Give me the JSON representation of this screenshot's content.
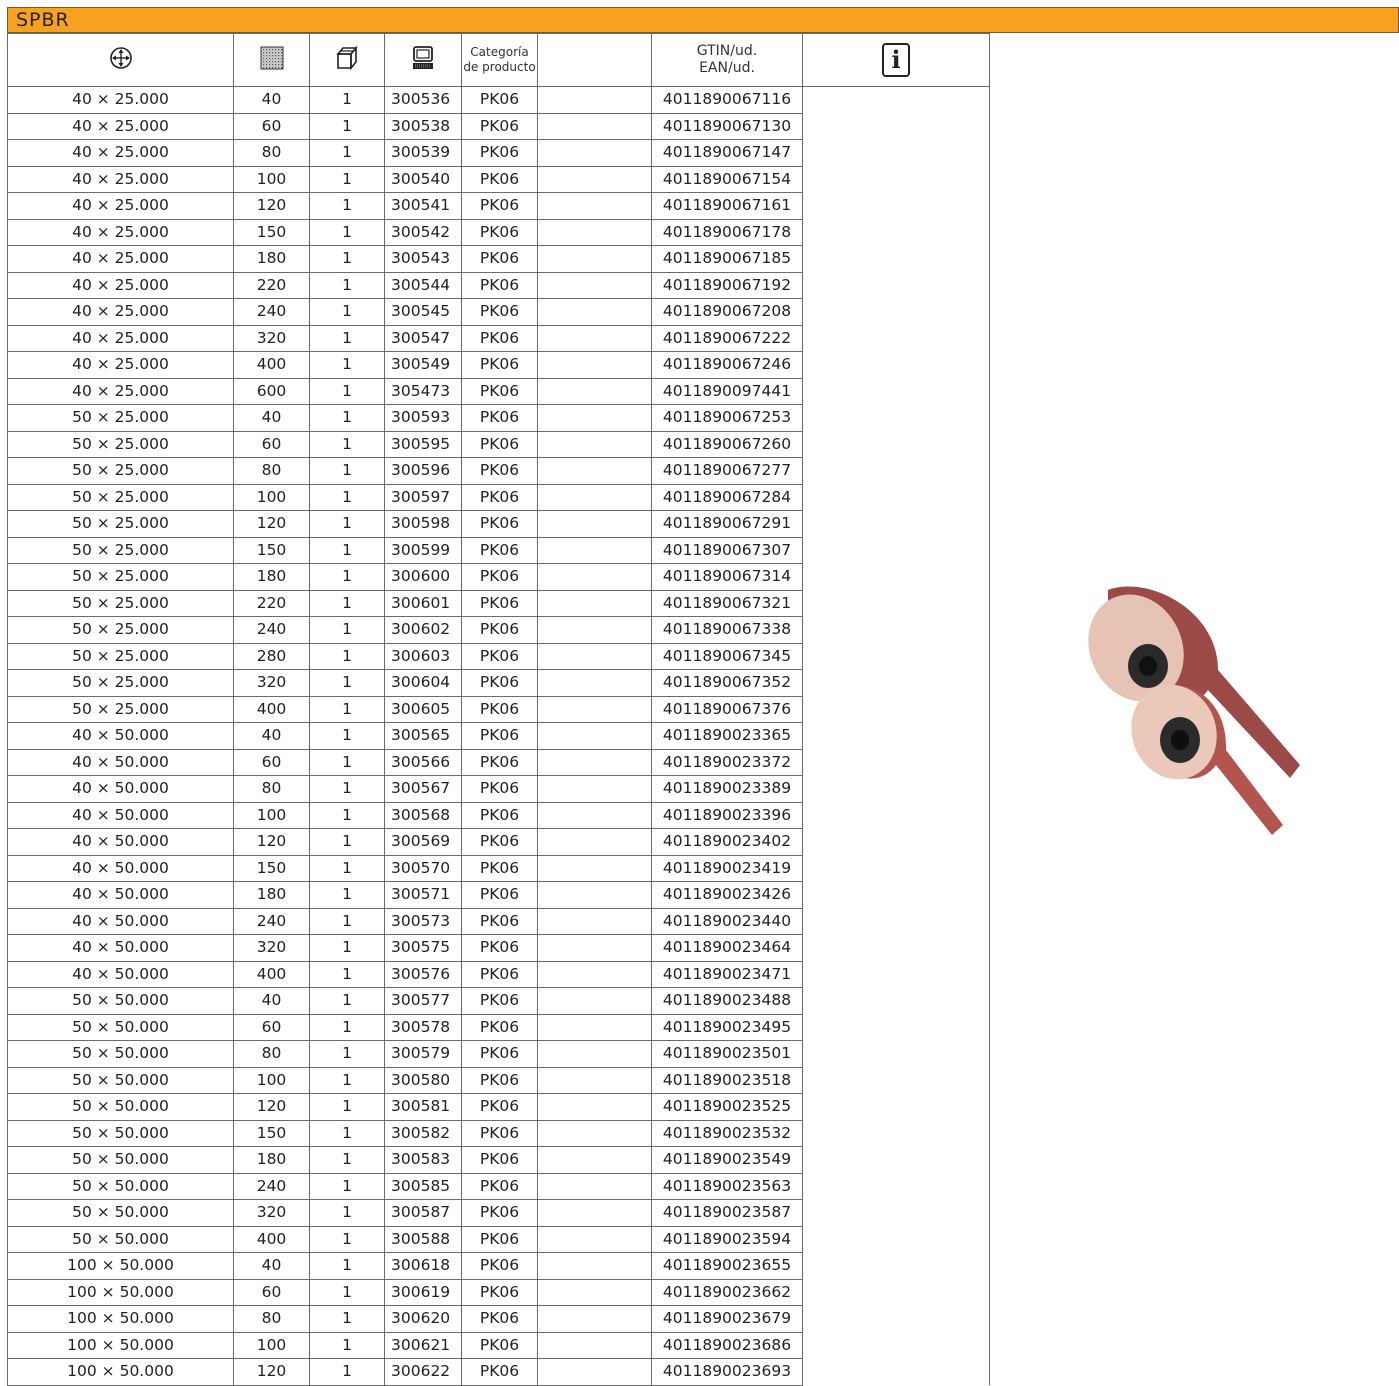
{
  "title": "SPBR",
  "colors": {
    "title_bar": "#f7a11e",
    "grid": "#6b6b6b"
  },
  "header": {
    "dimensions_icon": "arrows-cross-circle-icon",
    "grit_icon": "grit-texture-icon",
    "pack_icon": "box-icon",
    "article_icon": "computer-icon",
    "category": [
      "Categoría",
      "de producto"
    ],
    "gtin": [
      "GTIN/ud.",
      "EAN/ud."
    ],
    "info_icon": "info-icon",
    "info_label": "i"
  },
  "rows": [
    {
      "dim": "40 × 25.000",
      "grit": "40",
      "pack": "1",
      "art": "300536",
      "cat": "PK06",
      "gtin": "4011890067116"
    },
    {
      "dim": "40 × 25.000",
      "grit": "60",
      "pack": "1",
      "art": "300538",
      "cat": "PK06",
      "gtin": "4011890067130"
    },
    {
      "dim": "40 × 25.000",
      "grit": "80",
      "pack": "1",
      "art": "300539",
      "cat": "PK06",
      "gtin": "4011890067147"
    },
    {
      "dim": "40 × 25.000",
      "grit": "100",
      "pack": "1",
      "art": "300540",
      "cat": "PK06",
      "gtin": "4011890067154"
    },
    {
      "dim": "40 × 25.000",
      "grit": "120",
      "pack": "1",
      "art": "300541",
      "cat": "PK06",
      "gtin": "4011890067161"
    },
    {
      "dim": "40 × 25.000",
      "grit": "150",
      "pack": "1",
      "art": "300542",
      "cat": "PK06",
      "gtin": "4011890067178"
    },
    {
      "dim": "40 × 25.000",
      "grit": "180",
      "pack": "1",
      "art": "300543",
      "cat": "PK06",
      "gtin": "4011890067185"
    },
    {
      "dim": "40 × 25.000",
      "grit": "220",
      "pack": "1",
      "art": "300544",
      "cat": "PK06",
      "gtin": "4011890067192"
    },
    {
      "dim": "40 × 25.000",
      "grit": "240",
      "pack": "1",
      "art": "300545",
      "cat": "PK06",
      "gtin": "4011890067208"
    },
    {
      "dim": "40 × 25.000",
      "grit": "320",
      "pack": "1",
      "art": "300547",
      "cat": "PK06",
      "gtin": "4011890067222"
    },
    {
      "dim": "40 × 25.000",
      "grit": "400",
      "pack": "1",
      "art": "300549",
      "cat": "PK06",
      "gtin": "4011890067246"
    },
    {
      "dim": "40 × 25.000",
      "grit": "600",
      "pack": "1",
      "art": "305473",
      "cat": "PK06",
      "gtin": "4011890097441"
    },
    {
      "dim": "50 × 25.000",
      "grit": "40",
      "pack": "1",
      "art": "300593",
      "cat": "PK06",
      "gtin": "4011890067253"
    },
    {
      "dim": "50 × 25.000",
      "grit": "60",
      "pack": "1",
      "art": "300595",
      "cat": "PK06",
      "gtin": "4011890067260"
    },
    {
      "dim": "50 × 25.000",
      "grit": "80",
      "pack": "1",
      "art": "300596",
      "cat": "PK06",
      "gtin": "4011890067277"
    },
    {
      "dim": "50 × 25.000",
      "grit": "100",
      "pack": "1",
      "art": "300597",
      "cat": "PK06",
      "gtin": "4011890067284"
    },
    {
      "dim": "50 × 25.000",
      "grit": "120",
      "pack": "1",
      "art": "300598",
      "cat": "PK06",
      "gtin": "4011890067291"
    },
    {
      "dim": "50 × 25.000",
      "grit": "150",
      "pack": "1",
      "art": "300599",
      "cat": "PK06",
      "gtin": "4011890067307"
    },
    {
      "dim": "50 × 25.000",
      "grit": "180",
      "pack": "1",
      "art": "300600",
      "cat": "PK06",
      "gtin": "4011890067314"
    },
    {
      "dim": "50 × 25.000",
      "grit": "220",
      "pack": "1",
      "art": "300601",
      "cat": "PK06",
      "gtin": "4011890067321"
    },
    {
      "dim": "50 × 25.000",
      "grit": "240",
      "pack": "1",
      "art": "300602",
      "cat": "PK06",
      "gtin": "4011890067338"
    },
    {
      "dim": "50 × 25.000",
      "grit": "280",
      "pack": "1",
      "art": "300603",
      "cat": "PK06",
      "gtin": "4011890067345"
    },
    {
      "dim": "50 × 25.000",
      "grit": "320",
      "pack": "1",
      "art": "300604",
      "cat": "PK06",
      "gtin": "4011890067352"
    },
    {
      "dim": "50 × 25.000",
      "grit": "400",
      "pack": "1",
      "art": "300605",
      "cat": "PK06",
      "gtin": "4011890067376"
    },
    {
      "dim": "40 × 50.000",
      "grit": "40",
      "pack": "1",
      "art": "300565",
      "cat": "PK06",
      "gtin": "4011890023365"
    },
    {
      "dim": "40 × 50.000",
      "grit": "60",
      "pack": "1",
      "art": "300566",
      "cat": "PK06",
      "gtin": "4011890023372"
    },
    {
      "dim": "40 × 50.000",
      "grit": "80",
      "pack": "1",
      "art": "300567",
      "cat": "PK06",
      "gtin": "4011890023389"
    },
    {
      "dim": "40 × 50.000",
      "grit": "100",
      "pack": "1",
      "art": "300568",
      "cat": "PK06",
      "gtin": "4011890023396"
    },
    {
      "dim": "40 × 50.000",
      "grit": "120",
      "pack": "1",
      "art": "300569",
      "cat": "PK06",
      "gtin": "4011890023402"
    },
    {
      "dim": "40 × 50.000",
      "grit": "150",
      "pack": "1",
      "art": "300570",
      "cat": "PK06",
      "gtin": "4011890023419"
    },
    {
      "dim": "40 × 50.000",
      "grit": "180",
      "pack": "1",
      "art": "300571",
      "cat": "PK06",
      "gtin": "4011890023426"
    },
    {
      "dim": "40 × 50.000",
      "grit": "240",
      "pack": "1",
      "art": "300573",
      "cat": "PK06",
      "gtin": "4011890023440"
    },
    {
      "dim": "40 × 50.000",
      "grit": "320",
      "pack": "1",
      "art": "300575",
      "cat": "PK06",
      "gtin": "4011890023464"
    },
    {
      "dim": "40 × 50.000",
      "grit": "400",
      "pack": "1",
      "art": "300576",
      "cat": "PK06",
      "gtin": "4011890023471"
    },
    {
      "dim": "50 × 50.000",
      "grit": "40",
      "pack": "1",
      "art": "300577",
      "cat": "PK06",
      "gtin": "4011890023488"
    },
    {
      "dim": "50 × 50.000",
      "grit": "60",
      "pack": "1",
      "art": "300578",
      "cat": "PK06",
      "gtin": "4011890023495"
    },
    {
      "dim": "50 × 50.000",
      "grit": "80",
      "pack": "1",
      "art": "300579",
      "cat": "PK06",
      "gtin": "4011890023501"
    },
    {
      "dim": "50 × 50.000",
      "grit": "100",
      "pack": "1",
      "art": "300580",
      "cat": "PK06",
      "gtin": "4011890023518"
    },
    {
      "dim": "50 × 50.000",
      "grit": "120",
      "pack": "1",
      "art": "300581",
      "cat": "PK06",
      "gtin": "4011890023525"
    },
    {
      "dim": "50 × 50.000",
      "grit": "150",
      "pack": "1",
      "art": "300582",
      "cat": "PK06",
      "gtin": "4011890023532"
    },
    {
      "dim": "50 × 50.000",
      "grit": "180",
      "pack": "1",
      "art": "300583",
      "cat": "PK06",
      "gtin": "4011890023549"
    },
    {
      "dim": "50 × 50.000",
      "grit": "240",
      "pack": "1",
      "art": "300585",
      "cat": "PK06",
      "gtin": "4011890023563"
    },
    {
      "dim": "50 × 50.000",
      "grit": "320",
      "pack": "1",
      "art": "300587",
      "cat": "PK06",
      "gtin": "4011890023587"
    },
    {
      "dim": "50 × 50.000",
      "grit": "400",
      "pack": "1",
      "art": "300588",
      "cat": "PK06",
      "gtin": "4011890023594"
    },
    {
      "dim": "100 × 50.000",
      "grit": "40",
      "pack": "1",
      "art": "300618",
      "cat": "PK06",
      "gtin": "4011890023655"
    },
    {
      "dim": "100 × 50.000",
      "grit": "60",
      "pack": "1",
      "art": "300619",
      "cat": "PK06",
      "gtin": "4011890023662"
    },
    {
      "dim": "100 × 50.000",
      "grit": "80",
      "pack": "1",
      "art": "300620",
      "cat": "PK06",
      "gtin": "4011890023679"
    },
    {
      "dim": "100 × 50.000",
      "grit": "100",
      "pack": "1",
      "art": "300621",
      "cat": "PK06",
      "gtin": "4011890023686"
    },
    {
      "dim": "100 × 50.000",
      "grit": "120",
      "pack": "1",
      "art": "300622",
      "cat": "PK06",
      "gtin": "4011890023693"
    }
  ]
}
